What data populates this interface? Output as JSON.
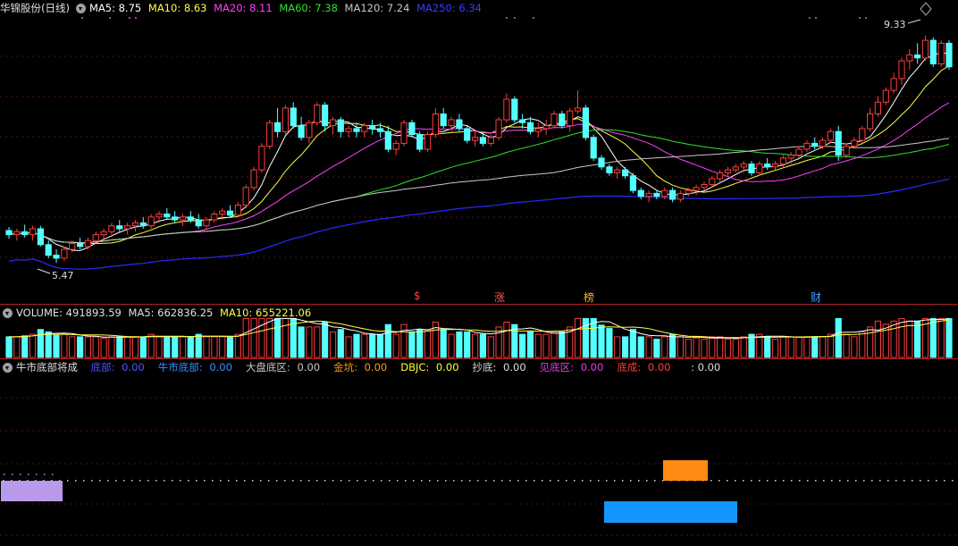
{
  "price_header": {
    "title": "华锦股份(日线)",
    "ma5": "MA5: 8.75",
    "ma10": "MA10: 8.63",
    "ma20": "MA20: 8.11",
    "ma60": "MA60: 7.38",
    "ma120": "MA120: 7.24",
    "ma250": "MA250: 6.34"
  },
  "volume_header": {
    "volume": "VOLUME: 491893.59",
    "ma5": "MA5: 662836.25",
    "ma10": "MA10: 655221.06"
  },
  "indicator_header": {
    "name": "牛市底部将成",
    "items": [
      {
        "label": "底部",
        "value": "0.00",
        "color": "#5050ff"
      },
      {
        "label": "牛市底部",
        "value": "0.00",
        "color": "#3b8cff"
      },
      {
        "label": "大盘底区",
        "value": "0.00",
        "color": "#c8c8c8"
      },
      {
        "label": "金坑",
        "value": "0.00",
        "color": "#ff9a1a"
      },
      {
        "label": "DBJC",
        "value": "0.00",
        "color": "#ffff33"
      },
      {
        "label": "抄底",
        "value": "0.00",
        "color": "#dddddd"
      },
      {
        "label": "见底区",
        "value": "0.00",
        "color": "#e040e0"
      },
      {
        "label": "底成",
        "value": "0.00",
        "color": "#ff3c3c"
      },
      {
        "label": "",
        "value": ": 0.00",
        "color": "#dddddd"
      }
    ]
  },
  "event_markers": [
    {
      "text": "$",
      "color": "#ff4040"
    },
    {
      "text": "涨",
      "color": "#ff5050"
    },
    {
      "text": "榜",
      "color": "#ffb030"
    },
    {
      "text": "财",
      "color": "#40a0ff"
    }
  ],
  "annotations": {
    "high": "9.33",
    "low": "5.47"
  },
  "colors": {
    "up": "#ff3c3c",
    "down": "#54ffff",
    "ma5": "#ffffff",
    "ma10": "#ffff40",
    "ma20": "#ff40ff",
    "ma60": "#30e030",
    "ma120": "#c8c8c8",
    "ma250": "#2a2aff"
  },
  "chart_data": {
    "type": "candlestick",
    "ylim": [
      5.2,
      9.6
    ],
    "candles": [
      [
        6.02,
        6.08,
        5.88,
        5.95
      ],
      [
        5.95,
        6.05,
        5.85,
        6.0
      ],
      [
        6.0,
        6.12,
        5.9,
        5.95
      ],
      [
        5.95,
        6.1,
        5.85,
        6.05
      ],
      [
        6.05,
        6.1,
        5.75,
        5.78
      ],
      [
        5.78,
        5.85,
        5.55,
        5.6
      ],
      [
        5.6,
        5.7,
        5.47,
        5.55
      ],
      [
        5.55,
        5.75,
        5.5,
        5.7
      ],
      [
        5.7,
        5.85,
        5.65,
        5.8
      ],
      [
        5.8,
        5.9,
        5.7,
        5.75
      ],
      [
        5.75,
        5.9,
        5.7,
        5.85
      ],
      [
        5.85,
        6.0,
        5.8,
        5.95
      ],
      [
        5.95,
        6.05,
        5.88,
        6.0
      ],
      [
        6.0,
        6.15,
        5.95,
        6.1
      ],
      [
        6.1,
        6.2,
        6.0,
        6.05
      ],
      [
        6.05,
        6.15,
        5.95,
        6.1
      ],
      [
        6.1,
        6.2,
        6.0,
        6.15
      ],
      [
        6.15,
        6.25,
        6.05,
        6.1
      ],
      [
        6.1,
        6.3,
        6.05,
        6.25
      ],
      [
        6.25,
        6.35,
        6.15,
        6.3
      ],
      [
        6.3,
        6.4,
        6.2,
        6.25
      ],
      [
        6.25,
        6.35,
        6.15,
        6.2
      ],
      [
        6.2,
        6.3,
        6.1,
        6.25
      ],
      [
        6.25,
        6.35,
        6.15,
        6.2
      ],
      [
        6.2,
        6.3,
        6.05,
        6.1
      ],
      [
        6.1,
        6.25,
        6.05,
        6.2
      ],
      [
        6.2,
        6.35,
        6.15,
        6.3
      ],
      [
        6.3,
        6.4,
        6.2,
        6.35
      ],
      [
        6.35,
        6.45,
        6.25,
        6.28
      ],
      [
        6.28,
        6.5,
        6.25,
        6.45
      ],
      [
        6.45,
        6.8,
        6.4,
        6.75
      ],
      [
        6.75,
        7.1,
        6.7,
        7.05
      ],
      [
        7.05,
        7.5,
        7.0,
        7.45
      ],
      [
        7.45,
        7.9,
        7.4,
        7.85
      ],
      [
        7.85,
        8.1,
        7.6,
        7.7
      ],
      [
        7.7,
        8.15,
        7.65,
        8.1
      ],
      [
        8.1,
        8.2,
        7.75,
        7.8
      ],
      [
        7.8,
        7.95,
        7.55,
        7.6
      ],
      [
        7.6,
        7.9,
        7.5,
        7.85
      ],
      [
        7.85,
        8.2,
        7.8,
        8.15
      ],
      [
        8.15,
        8.2,
        7.7,
        7.8
      ],
      [
        7.8,
        7.95,
        7.65,
        7.9
      ],
      [
        7.9,
        7.95,
        7.6,
        7.7
      ],
      [
        7.7,
        7.8,
        7.6,
        7.75
      ],
      [
        7.75,
        7.85,
        7.6,
        7.7
      ],
      [
        7.7,
        7.85,
        7.6,
        7.8
      ],
      [
        7.8,
        7.9,
        7.65,
        7.75
      ],
      [
        7.75,
        7.85,
        7.6,
        7.7
      ],
      [
        7.7,
        7.8,
        7.35,
        7.4
      ],
      [
        7.4,
        7.55,
        7.3,
        7.5
      ],
      [
        7.5,
        7.9,
        7.45,
        7.85
      ],
      [
        7.85,
        7.9,
        7.6,
        7.65
      ],
      [
        7.65,
        7.7,
        7.35,
        7.4
      ],
      [
        7.4,
        7.7,
        7.35,
        7.65
      ],
      [
        7.65,
        8.1,
        7.6,
        8.0
      ],
      [
        8.0,
        8.1,
        7.75,
        7.8
      ],
      [
        7.8,
        7.95,
        7.7,
        7.9
      ],
      [
        7.9,
        8.0,
        7.7,
        7.75
      ],
      [
        7.75,
        7.8,
        7.5,
        7.55
      ],
      [
        7.55,
        7.7,
        7.45,
        7.6
      ],
      [
        7.6,
        7.7,
        7.45,
        7.5
      ],
      [
        7.5,
        7.65,
        7.45,
        7.6
      ],
      [
        7.6,
        7.95,
        7.55,
        7.9
      ],
      [
        7.9,
        8.35,
        7.85,
        8.25
      ],
      [
        8.25,
        8.3,
        7.85,
        7.9
      ],
      [
        7.9,
        8.0,
        7.75,
        7.85
      ],
      [
        7.85,
        7.95,
        7.65,
        7.7
      ],
      [
        7.7,
        7.85,
        7.6,
        7.75
      ],
      [
        7.75,
        7.9,
        7.65,
        7.8
      ],
      [
        7.8,
        8.05,
        7.75,
        8.0
      ],
      [
        8.0,
        8.05,
        7.75,
        7.8
      ],
      [
        7.8,
        8.1,
        7.7,
        8.05
      ],
      [
        8.05,
        8.4,
        8.0,
        8.1
      ],
      [
        8.1,
        8.15,
        7.55,
        7.6
      ],
      [
        7.6,
        7.65,
        7.2,
        7.25
      ],
      [
        7.25,
        7.3,
        7.05,
        7.1
      ],
      [
        7.1,
        7.15,
        6.95,
        7.0
      ],
      [
        7.0,
        7.1,
        6.9,
        7.05
      ],
      [
        7.05,
        7.1,
        6.9,
        6.95
      ],
      [
        6.95,
        7.0,
        6.65,
        6.7
      ],
      [
        6.7,
        6.75,
        6.55,
        6.6
      ],
      [
        6.6,
        6.7,
        6.5,
        6.65
      ],
      [
        6.65,
        6.7,
        6.55,
        6.6
      ],
      [
        6.6,
        6.75,
        6.55,
        6.7
      ],
      [
        6.7,
        6.75,
        6.5,
        6.55
      ],
      [
        6.55,
        6.7,
        6.5,
        6.65
      ],
      [
        6.65,
        6.75,
        6.6,
        6.7
      ],
      [
        6.7,
        6.8,
        6.62,
        6.75
      ],
      [
        6.75,
        6.85,
        6.7,
        6.8
      ],
      [
        6.8,
        6.95,
        6.75,
        6.9
      ],
      [
        6.9,
        7.05,
        6.85,
        7.0
      ],
      [
        7.0,
        7.1,
        6.95,
        7.05
      ],
      [
        7.05,
        7.15,
        7.0,
        7.1
      ],
      [
        7.1,
        7.2,
        7.0,
        7.15
      ],
      [
        7.15,
        7.2,
        6.95,
        7.0
      ],
      [
        7.0,
        7.2,
        6.95,
        7.15
      ],
      [
        7.15,
        7.25,
        7.05,
        7.1
      ],
      [
        7.1,
        7.2,
        7.05,
        7.15
      ],
      [
        7.15,
        7.3,
        7.1,
        7.25
      ],
      [
        7.25,
        7.35,
        7.15,
        7.3
      ],
      [
        7.3,
        7.45,
        7.25,
        7.4
      ],
      [
        7.4,
        7.55,
        7.35,
        7.5
      ],
      [
        7.5,
        7.6,
        7.4,
        7.45
      ],
      [
        7.45,
        7.6,
        7.4,
        7.55
      ],
      [
        7.55,
        7.75,
        7.5,
        7.7
      ],
      [
        7.7,
        7.8,
        7.2,
        7.3
      ],
      [
        7.3,
        7.5,
        7.25,
        7.45
      ],
      [
        7.45,
        7.6,
        7.4,
        7.55
      ],
      [
        7.55,
        7.8,
        7.5,
        7.75
      ],
      [
        7.75,
        8.1,
        7.7,
        8.0
      ],
      [
        8.0,
        8.3,
        7.95,
        8.2
      ],
      [
        8.2,
        8.45,
        8.15,
        8.4
      ],
      [
        8.4,
        8.7,
        8.35,
        8.6
      ],
      [
        8.6,
        8.95,
        8.5,
        8.9
      ],
      [
        8.9,
        9.1,
        8.75,
        9.0
      ],
      [
        9.0,
        9.2,
        8.85,
        8.95
      ],
      [
        8.95,
        9.33,
        8.9,
        9.25
      ],
      [
        9.25,
        9.3,
        8.8,
        8.85
      ],
      [
        8.85,
        9.25,
        8.8,
        9.2
      ],
      [
        9.2,
        9.25,
        8.75,
        8.8
      ]
    ],
    "volume_ylim": [
      0,
      1400000
    ]
  }
}
